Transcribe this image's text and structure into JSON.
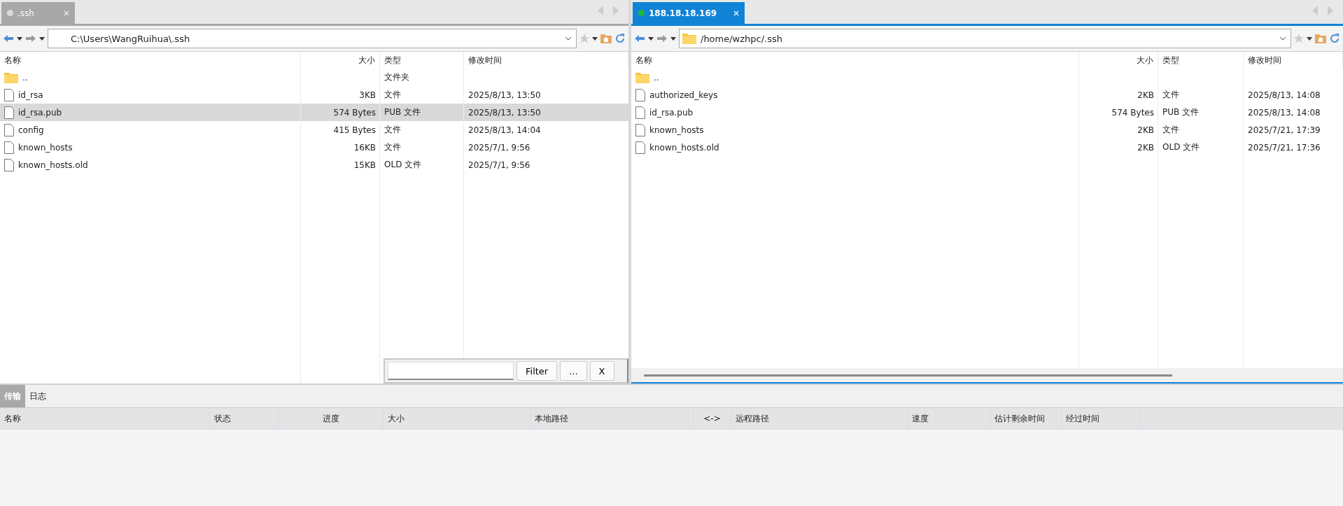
{
  "panes": [
    {
      "tab": {
        "label": ".ssh",
        "selected": false,
        "connected": false
      },
      "path": "C:\\Users\\WangRuihua\\.ssh",
      "path_icon": false,
      "columns": [
        "名称",
        "大小",
        "类型",
        "修改时间"
      ],
      "rows": [
        {
          "kind": "folder",
          "name": "..",
          "size": "",
          "type": "文件夹",
          "modified": "",
          "selected": false
        },
        {
          "kind": "file",
          "name": "id_rsa",
          "size": "3KB",
          "type": "文件",
          "modified": "2025/8/13, 13:50",
          "selected": false
        },
        {
          "kind": "file",
          "name": "id_rsa.pub",
          "size": "574 Bytes",
          "type": "PUB 文件",
          "modified": "2025/8/13, 13:50",
          "selected": true
        },
        {
          "kind": "file",
          "name": "config",
          "size": "415 Bytes",
          "type": "文件",
          "modified": "2025/8/13, 14:04",
          "selected": false
        },
        {
          "kind": "file",
          "name": "known_hosts",
          "size": "16KB",
          "type": "文件",
          "modified": "2025/7/1, 9:56",
          "selected": false
        },
        {
          "kind": "file",
          "name": "known_hosts.old",
          "size": "15KB",
          "type": "OLD 文件",
          "modified": "2025/7/1, 9:56",
          "selected": false
        }
      ],
      "filter": {
        "buttons": [
          "Filter",
          "...",
          "X"
        ]
      }
    },
    {
      "tab": {
        "label": "188.18.18.169",
        "selected": true,
        "connected": true
      },
      "path": "/home/wzhpc/.ssh",
      "path_icon": true,
      "columns": [
        "名称",
        "大小",
        "类型",
        "修改时间"
      ],
      "rows": [
        {
          "kind": "folder",
          "name": "..",
          "size": "",
          "type": "",
          "modified": "",
          "selected": false
        },
        {
          "kind": "file",
          "name": "authorized_keys",
          "size": "2KB",
          "type": "文件",
          "modified": "2025/8/13, 14:08",
          "selected": false
        },
        {
          "kind": "file",
          "name": "id_rsa.pub",
          "size": "574 Bytes",
          "type": "PUB 文件",
          "modified": "2025/8/13, 14:08",
          "selected": false
        },
        {
          "kind": "file",
          "name": "known_hosts",
          "size": "2KB",
          "type": "文件",
          "modified": "2025/7/21, 17:39",
          "selected": false
        },
        {
          "kind": "file",
          "name": "known_hosts.old",
          "size": "2KB",
          "type": "OLD 文件",
          "modified": "2025/7/21, 17:36",
          "selected": false
        }
      ]
    }
  ],
  "bottom_tabs": [
    {
      "label": "传输",
      "selected": true
    },
    {
      "label": "日志",
      "selected": false
    }
  ],
  "transfer_columns": [
    "名称",
    "状态",
    "进度",
    "大小",
    "本地路径",
    "<->",
    "远程路径",
    "速度",
    "估计剩余时间",
    "经过时间"
  ]
}
